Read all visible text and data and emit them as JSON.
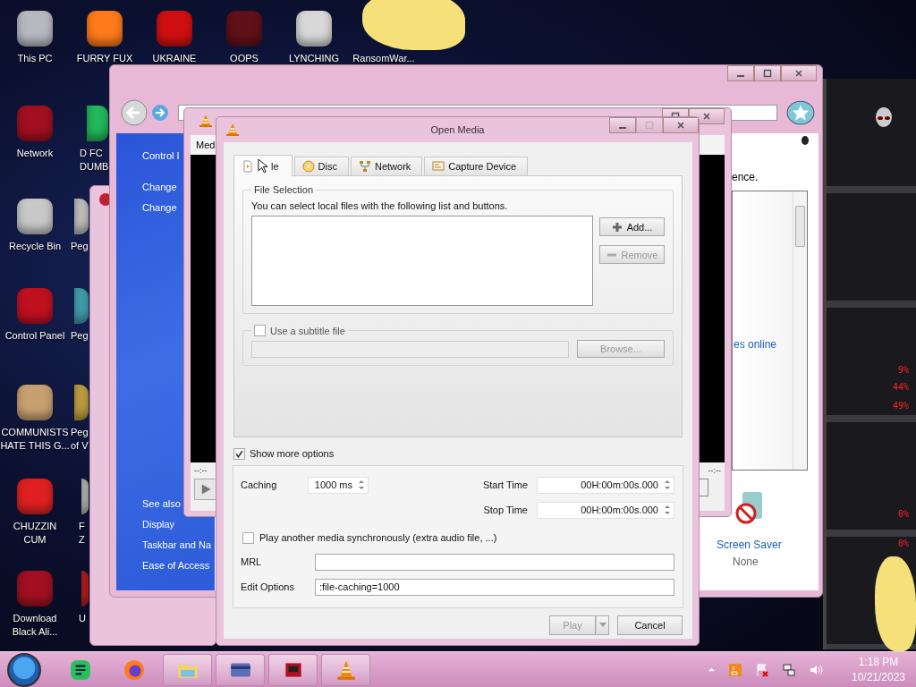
{
  "desktop_icons": [
    {
      "label": "This PC"
    },
    {
      "label": "FURRY FUX"
    },
    {
      "label": "UKRAINE"
    },
    {
      "label": "OOPS"
    },
    {
      "label": "LYNCHING"
    },
    {
      "label": "RansomWar..."
    },
    {
      "label": "Network"
    },
    {
      "label": "D FC\nDUMB"
    },
    {
      "label": "Recycle Bin"
    },
    {
      "label": "Peg"
    },
    {
      "label": "Control Panel"
    },
    {
      "label": "Peg"
    },
    {
      "label": "COMMUNISTS\nHATE THIS G..."
    },
    {
      "label": "Peg\nof V"
    },
    {
      "label": "CHUZZIN\nCUM"
    },
    {
      "label": "F\nZ"
    },
    {
      "label": "Download\nBlack Ali..."
    },
    {
      "label": "U"
    }
  ],
  "control_panel_window": {
    "sidebar": {
      "links": [
        "Control I",
        "Change",
        "Change"
      ],
      "see_also_heading": "See also",
      "see_also_links": [
        "Display",
        "Taskbar and Na",
        "Ease of Access"
      ]
    },
    "content": {
      "text": "ence.",
      "link": "es online",
      "screen_saver": {
        "label": "Screen Saver",
        "value": "None"
      }
    }
  },
  "media_player_window": {
    "menu": "Med",
    "elapsed": "--:--",
    "total": "--:--"
  },
  "dialog": {
    "title": "Open Media",
    "tabs": [
      {
        "label": "le",
        "kind": "file",
        "selected": true
      },
      {
        "label": "Disc",
        "kind": "disc",
        "selected": false
      },
      {
        "label": "Network",
        "kind": "network",
        "selected": false
      },
      {
        "label": "Capture Device",
        "kind": "capture",
        "selected": false
      }
    ],
    "file_selection": {
      "legend": "File Selection",
      "hint": "You can select local files with the following list and buttons.",
      "buttons": [
        {
          "label": "Add...",
          "kind": "add",
          "disabled": false
        },
        {
          "label": "Remove",
          "kind": "remove",
          "disabled": true
        }
      ]
    },
    "subtitle": {
      "label": "Use a subtitle file",
      "checked": false,
      "browse": {
        "label": "Browse...",
        "disabled": true
      }
    },
    "show_more_options": {
      "label": "Show more options",
      "checked": true
    },
    "options": {
      "caching": {
        "label": "Caching",
        "value": "1000 ms"
      },
      "start_time": {
        "label": "Start Time",
        "value": "00H:00m:00s.000"
      },
      "stop_time": {
        "label": "Stop Time",
        "value": "00H:00m:00s.000"
      },
      "play_another": {
        "label": "Play another media synchronously (extra audio file, ...)",
        "checked": false
      },
      "mrl": {
        "label": "MRL"
      },
      "edit_options": {
        "label": "Edit Options",
        "value": ":file-caching=1000"
      }
    },
    "buttons": {
      "play": {
        "label": "Play",
        "disabled": true
      },
      "cancel": {
        "label": "Cancel",
        "disabled": false
      }
    }
  },
  "gauge_widget": {
    "readings": [
      "9%",
      "44%",
      "49%",
      "0%",
      "0%"
    ]
  },
  "taskbar": {
    "time": "1:18 PM",
    "date": "10/21/2023"
  }
}
